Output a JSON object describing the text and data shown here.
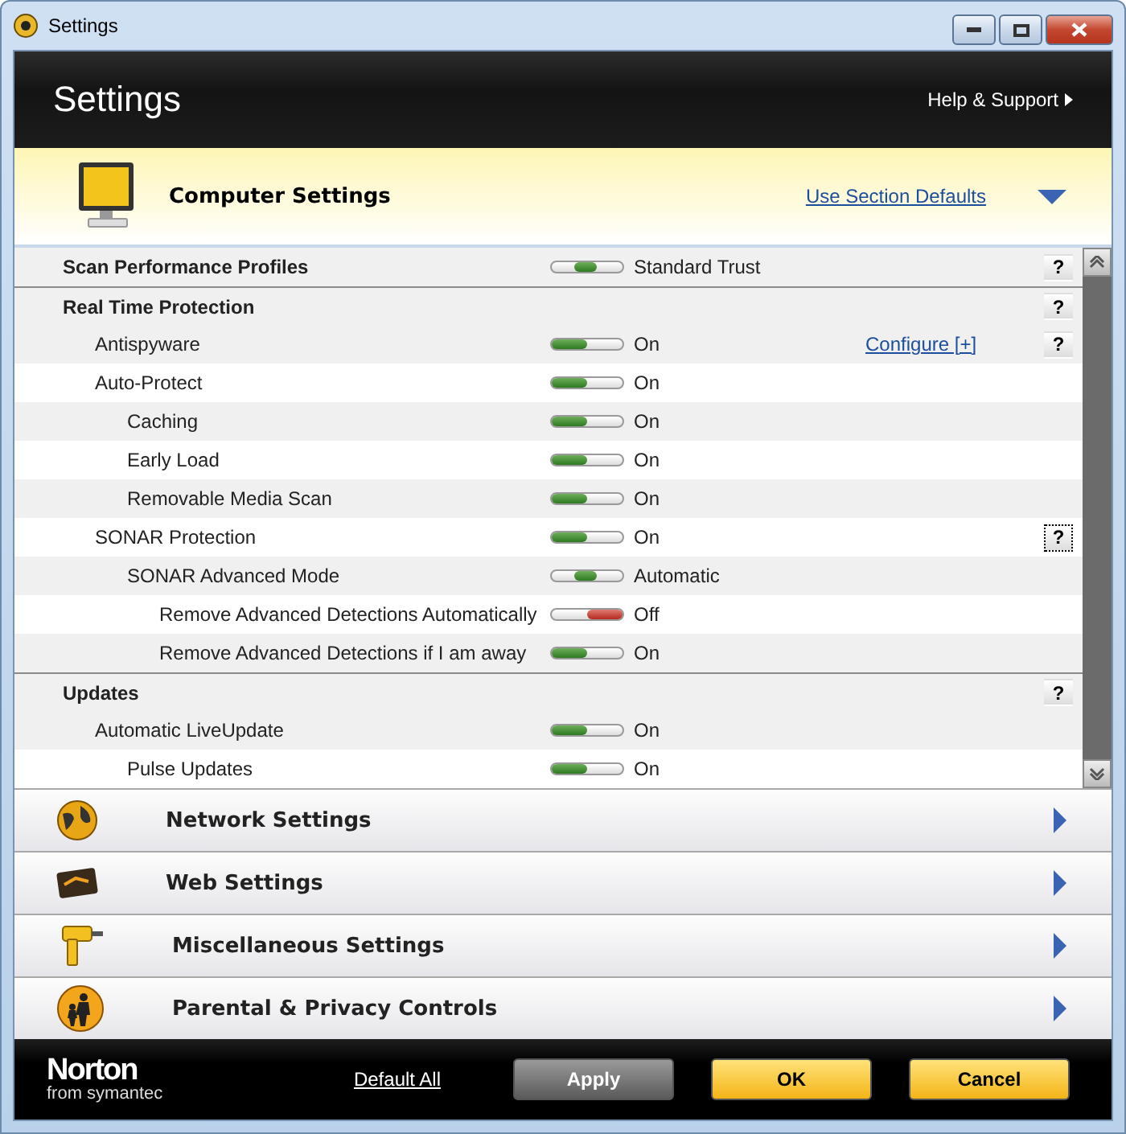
{
  "window": {
    "title": "Settings"
  },
  "header": {
    "title": "Settings",
    "help_link": "Help & Support"
  },
  "section": {
    "title": "Computer Settings",
    "defaults_link": "Use Section Defaults",
    "expanded": true
  },
  "groups": [
    {
      "title": "Scan Performance Profiles",
      "kind": "middle",
      "value": "Standard Trust",
      "help": "?"
    },
    {
      "title": "Real Time Protection",
      "help": "?",
      "items": [
        {
          "label": "Antispyware",
          "kind": "on",
          "value": "On",
          "link": "Configure [+]",
          "help": "?"
        },
        {
          "label": "Auto-Protect",
          "kind": "on",
          "value": "On",
          "children": [
            {
              "label": "Caching",
              "kind": "on",
              "value": "On"
            },
            {
              "label": "Early Load",
              "kind": "on",
              "value": "On"
            },
            {
              "label": "Removable Media Scan",
              "kind": "on",
              "value": "On"
            }
          ]
        },
        {
          "label": "SONAR Protection",
          "kind": "on",
          "value": "On",
          "help": "?",
          "help_focused": true,
          "children": [
            {
              "label": "SONAR Advanced Mode",
              "kind": "middle",
              "value": "Automatic",
              "children": [
                {
                  "label": "Remove Advanced Detections Automatically",
                  "kind": "off",
                  "value": "Off"
                },
                {
                  "label": "Remove Advanced Detections if I am away",
                  "kind": "on",
                  "value": "On"
                }
              ]
            }
          ]
        }
      ]
    },
    {
      "title": "Updates",
      "help": "?",
      "items": [
        {
          "label": "Automatic LiveUpdate",
          "kind": "on",
          "value": "On",
          "children": [
            {
              "label": "Pulse Updates",
              "kind": "on",
              "value": "On"
            }
          ]
        }
      ]
    }
  ],
  "categories": [
    {
      "label": "Network Settings",
      "kind": "globe"
    },
    {
      "label": "Web Settings",
      "kind": "card"
    },
    {
      "label": "Miscellaneous Settings",
      "kind": "drill"
    },
    {
      "label": "Parental & Privacy Controls",
      "kind": "family"
    }
  ],
  "footer": {
    "logo": "Norton",
    "logo_sub": "from symantec",
    "default_link": "Default All",
    "buttons": [
      {
        "label": "Apply",
        "kind": "gray"
      },
      {
        "label": "OK",
        "kind": "yellow"
      },
      {
        "label": "Cancel",
        "kind": "yellow"
      }
    ]
  }
}
